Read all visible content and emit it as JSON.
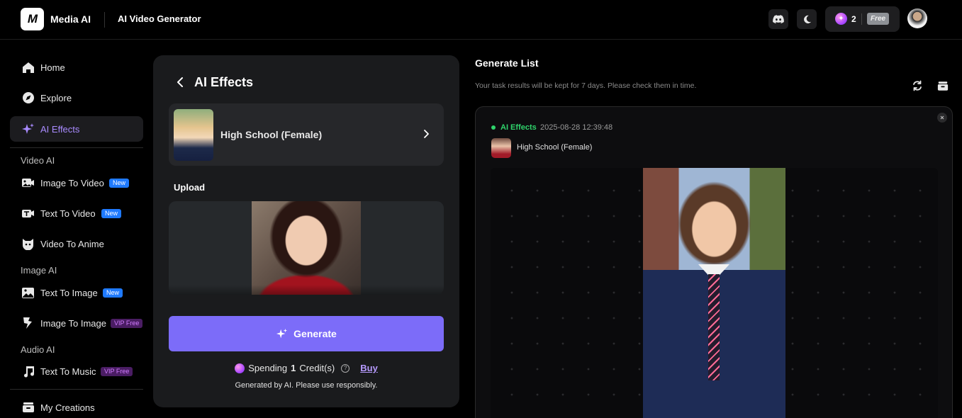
{
  "app": {
    "brand": "Media AI",
    "logo_text": "M",
    "page_name": "AI Video Generator"
  },
  "topbar": {
    "credits": "2",
    "plan_badge": "Free",
    "icons": [
      "discord-icon",
      "moon-icon",
      "credit-orb-icon",
      "avatar"
    ]
  },
  "sidebar": {
    "home": "Home",
    "explore": "Explore",
    "ai_effects": "AI Effects",
    "section_video": "Video AI",
    "image_to_video": "Image To Video",
    "image_to_video_badge": "New",
    "text_to_video": "Text To Video",
    "text_to_video_badge": "New",
    "video_to_anime": "Video To Anime",
    "section_image": "Image AI",
    "text_to_image": "Text To Image",
    "text_to_image_badge": "New",
    "image_to_image": "Image To Image",
    "image_to_image_badge": "VIP Free",
    "section_audio": "Audio AI",
    "text_to_music": "Text To Music",
    "text_to_music_badge": "VIP Free",
    "my_creations": "My Creations"
  },
  "panel": {
    "title": "AI Effects",
    "effect_name": "High School (Female)",
    "upload_label": "Upload",
    "generate_label": "Generate",
    "spending_prefix": "Spending",
    "spending_amount": "1",
    "spending_suffix": "Credit(s)",
    "buy_label": "Buy",
    "disclaimer": "Generated by AI. Please use responsibly."
  },
  "generate_list": {
    "title": "Generate List",
    "subtitle": "Your task results will be kept for 7 days. Please check them in time.",
    "item": {
      "type_label": "AI Effects",
      "timestamp": "2025-08-28 12:39:48",
      "effect_name": "High School (Female)"
    }
  },
  "colors": {
    "accent": "#7c6cf9",
    "active_nav_text": "#a98bff",
    "status_green": "#2fd36b",
    "new_badge": "#1f7aff",
    "vip_badge": "#4a1d63"
  }
}
